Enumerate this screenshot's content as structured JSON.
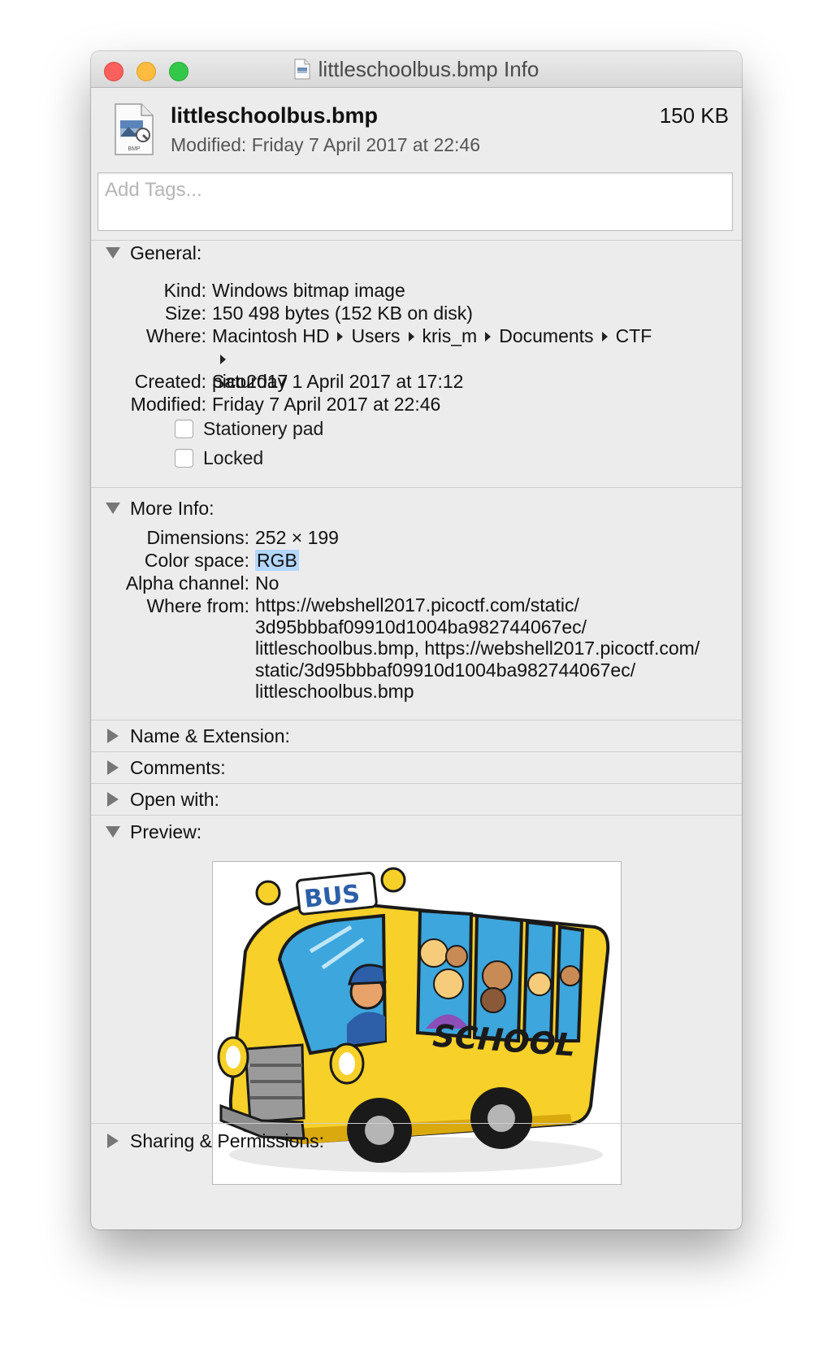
{
  "window": {
    "title": "littleschoolbus.bmp Info",
    "traffic_lights": {
      "close": "#fc605c",
      "minimize": "#fdbc40",
      "zoom": "#34c84a"
    }
  },
  "header": {
    "file_name": "littleschoolbus.bmp",
    "size": "150 KB",
    "modified": "Modified: Friday 7 April 2017 at 22:46",
    "icon": "bmp-document-icon",
    "icon_badge": "BMP"
  },
  "tags": {
    "placeholder": "Add Tags..."
  },
  "sections": {
    "general": {
      "label": "General:",
      "expanded": true,
      "kind_label": "Kind:",
      "kind": "Windows bitmap image",
      "size_label": "Size:",
      "size": "150 498 bytes (152 KB on disk)",
      "where_label": "Where:",
      "where": [
        "Macintosh HD",
        "Users",
        "kris_m",
        "Documents",
        "CTF",
        "pico2017"
      ],
      "created_label": "Created:",
      "created": "Saturday 1 April 2017 at 17:12",
      "modified_label": "Modified:",
      "modified": "Friday 7 April 2017 at 22:46",
      "stationery_label": "Stationery pad",
      "stationery_checked": false,
      "locked_label": "Locked",
      "locked_checked": false
    },
    "more_info": {
      "label": "More Info:",
      "expanded": true,
      "dimensions_label": "Dimensions:",
      "dimensions": "252 × 199",
      "color_space_label": "Color space:",
      "color_space": "RGB",
      "alpha_label": "Alpha channel:",
      "alpha": "No",
      "where_from_label": "Where from:",
      "where_from": [
        "https://webshell2017.picoctf.com/static/",
        "3d95bbbaf09910d1004ba982744067ec/",
        "littleschoolbus.bmp, https://webshell2017.picoctf.com/",
        "static/3d95bbbaf09910d1004ba982744067ec/",
        "littleschoolbus.bmp"
      ]
    },
    "name_extension": {
      "label": "Name & Extension:",
      "expanded": false
    },
    "comments": {
      "label": "Comments:",
      "expanded": false
    },
    "open_with": {
      "label": "Open with:",
      "expanded": false
    },
    "preview": {
      "label": "Preview:",
      "expanded": true,
      "bus_sign": "BUS",
      "bus_text": "SCHOOL"
    },
    "sharing": {
      "label": "Sharing & Permissions:",
      "expanded": false
    }
  }
}
